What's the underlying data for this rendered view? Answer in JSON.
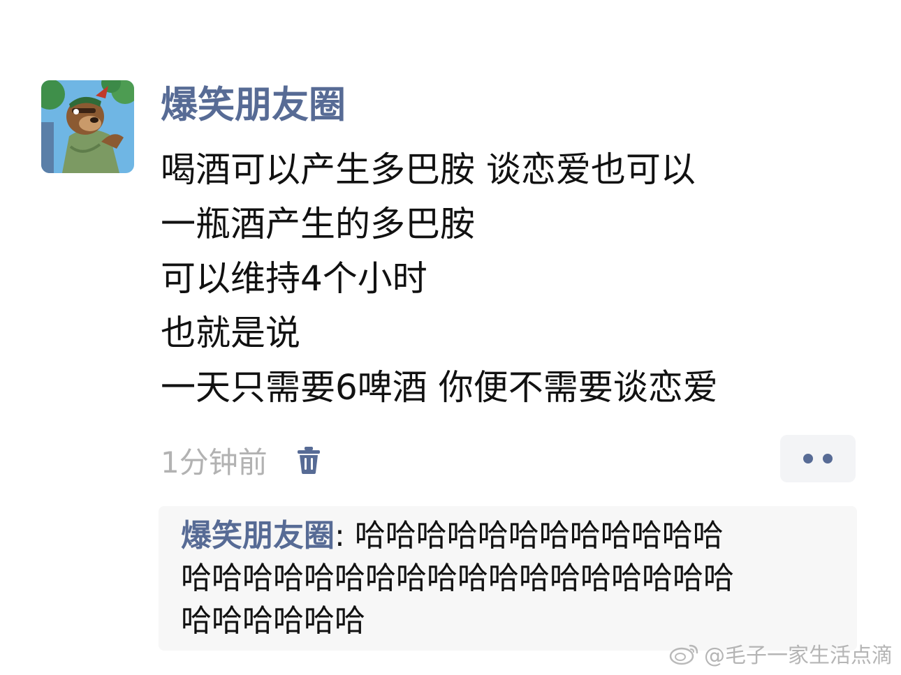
{
  "post": {
    "author": "爆笑朋友圈",
    "lines": [
      "喝酒可以产生多巴胺 谈恋爱也可以",
      "一瓶酒产生的多巴胺",
      "可以维持4个小时",
      "也就是说",
      "一天只需要6啤酒 你便不需要谈恋爱"
    ],
    "timestamp": "1分钟前"
  },
  "comment": {
    "author": "爆笑朋友圈",
    "separator": ": ",
    "lines": [
      "哈哈哈哈哈哈哈哈哈哈哈哈",
      "哈哈哈哈哈哈哈哈哈哈哈哈哈哈哈哈哈哈",
      "哈哈哈哈哈哈"
    ]
  },
  "watermark": {
    "text": "@毛子一家生活点滴"
  },
  "icons": {
    "avatar": "cartoon-bear-avatar",
    "delete": "trash-icon",
    "more": "more-dots-icon",
    "watermark_logo": "weibo-logo-icon"
  },
  "colors": {
    "name_link": "#576b95",
    "timestamp": "#b2b2b2",
    "comment_bg": "#f7f7f7",
    "more_bg": "#f3f4f6",
    "text": "#111111"
  }
}
